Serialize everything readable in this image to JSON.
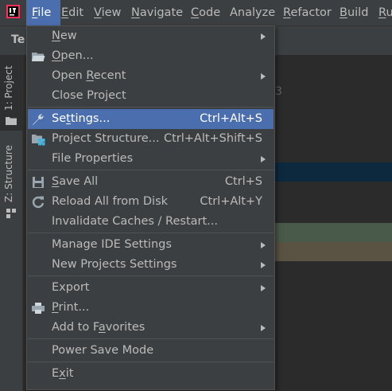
{
  "menubar": {
    "items": [
      "File",
      "Edit",
      "View",
      "Navigate",
      "Code",
      "Analyze",
      "Refactor",
      "Build",
      "Ru"
    ],
    "mnemonics": [
      "F",
      "E",
      "V",
      "N",
      "C",
      "",
      "R",
      "B",
      "R"
    ]
  },
  "toolbar": {
    "title": "Te",
    "partial_text": "3"
  },
  "sidebar": {
    "tabs": [
      "1: Project",
      "Z: Structure"
    ]
  },
  "file_menu": {
    "items": [
      {
        "label": "New",
        "mnemonic": "N",
        "shortcut": "",
        "submenu": true,
        "icon": ""
      },
      {
        "label": "Open...",
        "mnemonic": "O",
        "shortcut": "",
        "submenu": false,
        "icon": "folder-icon"
      },
      {
        "label": "Open Recent",
        "mnemonic": "R",
        "shortcut": "",
        "submenu": true,
        "icon": ""
      },
      {
        "label": "Close Project",
        "mnemonic": "",
        "shortcut": "",
        "submenu": false,
        "icon": ""
      },
      {
        "label": "Settings...",
        "mnemonic": "t",
        "shortcut": "Ctrl+Alt+S",
        "submenu": false,
        "icon": "wrench-icon",
        "highlighted": true
      },
      {
        "label": "Project Structure...",
        "mnemonic": "",
        "shortcut": "Ctrl+Alt+Shift+S",
        "submenu": false,
        "icon": "project-structure-icon"
      },
      {
        "label": "File Properties",
        "mnemonic": "",
        "shortcut": "",
        "submenu": true,
        "icon": ""
      },
      {
        "label": "Save All",
        "mnemonic": "S",
        "shortcut": "Ctrl+S",
        "submenu": false,
        "icon": "save-icon"
      },
      {
        "label": "Reload All from Disk",
        "mnemonic": "",
        "shortcut": "Ctrl+Alt+Y",
        "submenu": false,
        "icon": "reload-icon"
      },
      {
        "label": "Invalidate Caches / Restart...",
        "mnemonic": "",
        "shortcut": "",
        "submenu": false,
        "icon": ""
      },
      {
        "label": "Manage IDE Settings",
        "mnemonic": "",
        "shortcut": "",
        "submenu": true,
        "icon": ""
      },
      {
        "label": "New Projects Settings",
        "mnemonic": "",
        "shortcut": "",
        "submenu": true,
        "icon": ""
      },
      {
        "label": "Export",
        "mnemonic": "",
        "shortcut": "",
        "submenu": true,
        "icon": ""
      },
      {
        "label": "Print...",
        "mnemonic": "P",
        "shortcut": "",
        "submenu": false,
        "icon": "printer-icon"
      },
      {
        "label": "Add to Favorites",
        "mnemonic": "a",
        "shortcut": "",
        "submenu": true,
        "icon": ""
      },
      {
        "label": "Power Save Mode",
        "mnemonic": "",
        "shortcut": "",
        "submenu": false,
        "icon": ""
      },
      {
        "label": "Exit",
        "mnemonic": "x",
        "shortcut": "",
        "submenu": false,
        "icon": ""
      }
    ]
  },
  "colors": {
    "menu_highlight": "#4b6eaf",
    "menu_bg": "#3c3f41",
    "editor_bg": "#2b2b2b",
    "editor_selection": "#0d293e",
    "stripe_green": "#4a5a4a",
    "stripe_brown": "#5a5343"
  }
}
